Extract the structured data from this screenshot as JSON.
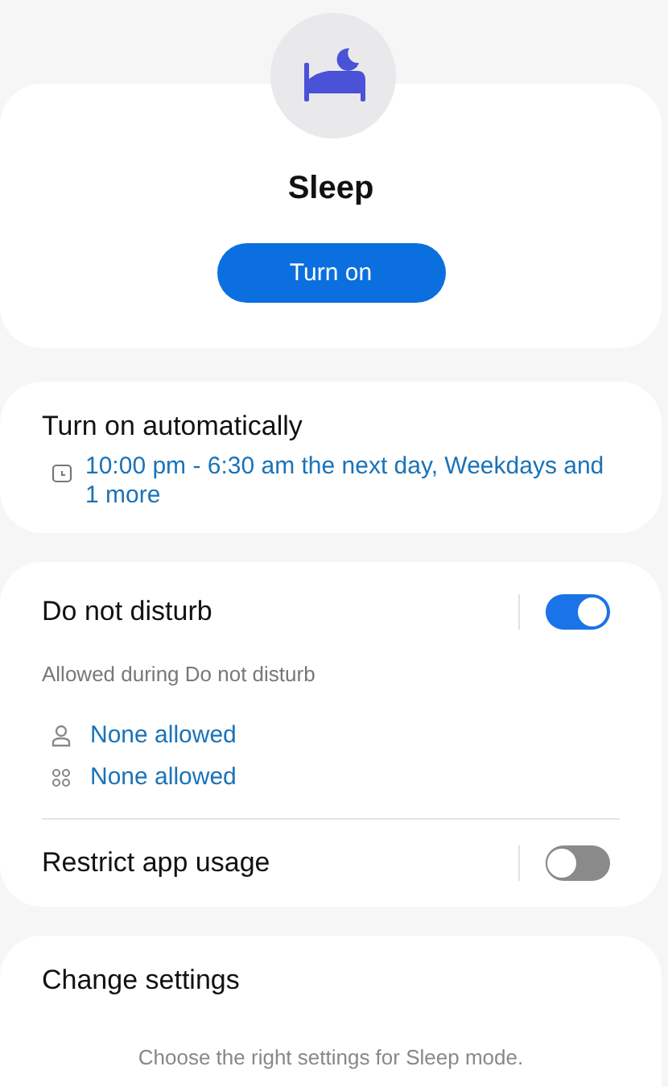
{
  "mode": {
    "title": "Sleep",
    "button": "Turn on"
  },
  "schedule": {
    "title": "Turn on automatically",
    "summary": "10:00 pm - 6:30 am the next day, Weekdays and 1 more"
  },
  "do_not_disturb": {
    "title": "Do not disturb",
    "on": true,
    "subtitle": "Allowed during Do not disturb",
    "allowed": [
      {
        "kind": "people",
        "label": "None allowed"
      },
      {
        "kind": "apps",
        "label": "None allowed"
      }
    ]
  },
  "restrict_app_usage": {
    "title": "Restrict app usage",
    "on": false
  },
  "change_settings": {
    "title": "Change settings",
    "description": "Choose the right settings for Sleep mode."
  }
}
